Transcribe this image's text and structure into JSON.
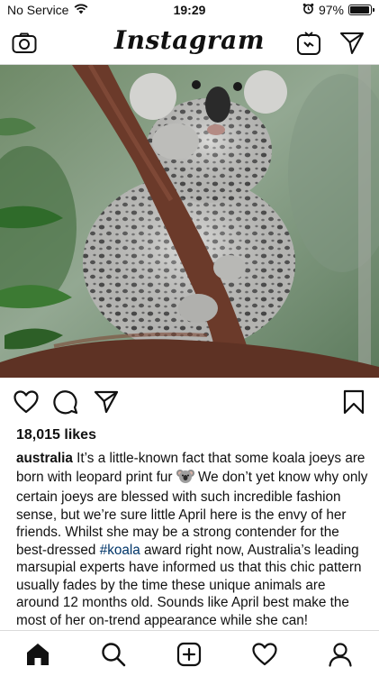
{
  "status": {
    "carrier": "No Service",
    "time": "19:29",
    "battery": "97%",
    "battery_level": 0.97
  },
  "header": {
    "logo": "Instagram",
    "icons": [
      "camera-icon",
      "igtv-icon",
      "direct-send-icon"
    ]
  },
  "post": {
    "image": "koala-joey-on-branch",
    "actions": [
      "heart-icon",
      "comment-icon",
      "share-icon",
      "bookmark-icon"
    ],
    "likes": "18,015 likes",
    "caption": {
      "username": "australia",
      "text_before_emoji": " It’s a little-known fact that some koala joeys are born with leopard print fur ",
      "emoji": "koala-emoji",
      "text_after_emoji": " We don’t yet know why only certain joeys are blessed with such incredible fashion sense, but we’re sure little April here is the envy of her friends. Whilst she may be a strong contender for the best-dressed ",
      "hashtag": "#koala",
      "text_after_hashtag": " award right now, Australia’s leading marsupial experts have informed us that this chic pattern usually fades by the time these unique animals are around 12 months old. Sounds like April best make the most of her on-trend appearance while she can!"
    }
  },
  "tabbar": {
    "icons": [
      "home-icon",
      "search-icon",
      "add-post-icon",
      "activity-heart-icon",
      "profile-icon"
    ]
  },
  "colors": {
    "hashtag": "#003569",
    "divider": "#dbdbdb",
    "text": "#111111"
  }
}
